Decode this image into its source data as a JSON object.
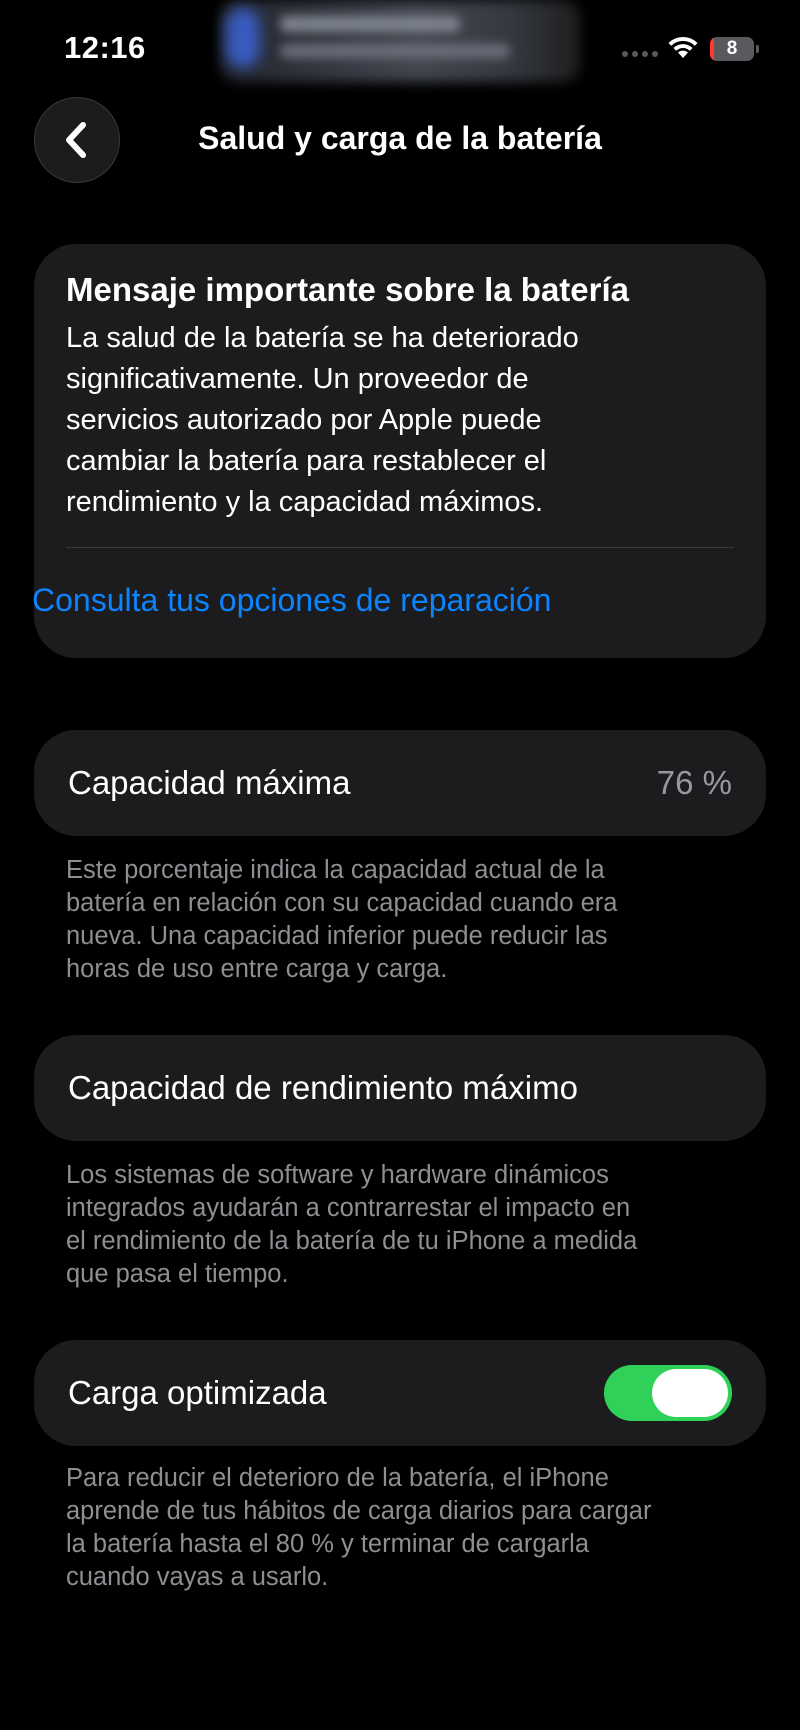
{
  "status_bar": {
    "time": "12:16",
    "battery_level": "8",
    "battery_fraction": 0.08,
    "battery_color": "#ff3b30",
    "icons": [
      "wifi-icon",
      "battery-icon",
      "signal-dots-icon"
    ]
  },
  "nav": {
    "back_icon": "chevron-left-icon",
    "title": "Salud y carga de la batería"
  },
  "message_card": {
    "title": "Mensaje importante sobre la batería",
    "body_lines": [
      "La salud de la batería se ha deteriorado",
      "significativamente. Un proveedor de",
      "servicios autorizado por Apple puede",
      "cambiar la batería para restablecer el",
      "rendimiento y la capacidad máximos."
    ],
    "link": "Consulta tus opciones de reparación",
    "link_color": "#0a84ff"
  },
  "max_capacity": {
    "label": "Capacidad máxima",
    "value": "76 %",
    "description_lines": [
      "Este porcentaje indica la capacidad actual de la",
      "batería en relación con su capacidad cuando era",
      "nueva. Una capacidad inferior puede reducir las",
      "horas de uso entre carga y carga."
    ]
  },
  "peak_performance": {
    "label": "Capacidad de rendimiento máximo",
    "description_lines": [
      "Los sistemas de software y hardware dinámicos",
      "integrados ayudarán a contrarrestar el impacto en",
      "el rendimiento de la batería de tu iPhone a medida",
      "que pasa el tiempo."
    ]
  },
  "optimized_charging": {
    "label": "Carga optimizada",
    "enabled": true,
    "toggle_color": "#30d158",
    "description_lines": [
      "Para reducir el deterioro de la batería, el iPhone",
      "aprende de tus hábitos de carga diarios para cargar",
      "la batería hasta el 80 % y terminar de cargarla",
      "cuando vayas a usarlo."
    ]
  }
}
